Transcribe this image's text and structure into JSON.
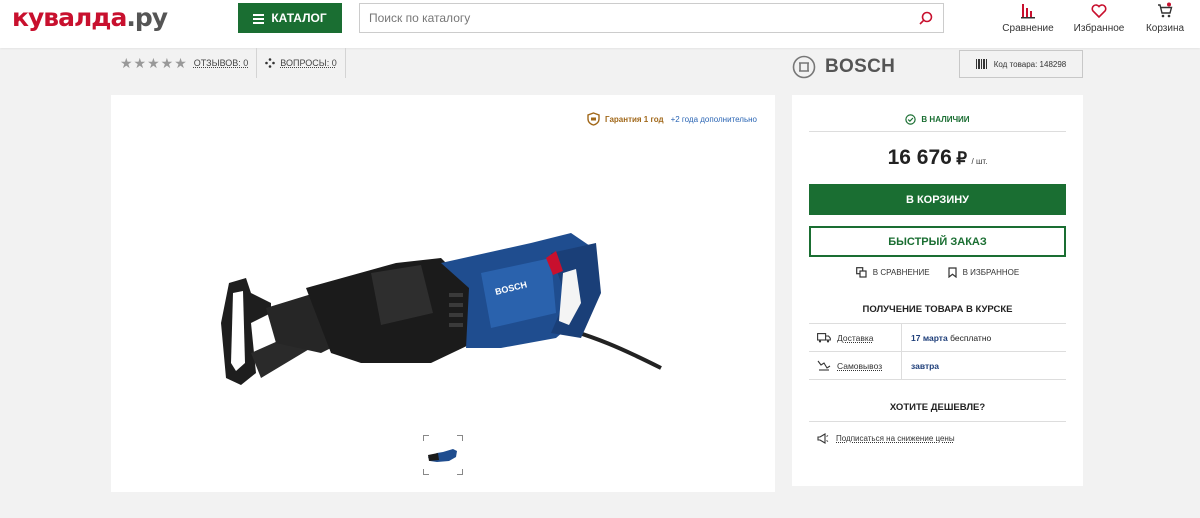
{
  "header": {
    "logo_main": "кувалда",
    "logo_suffix": ".ру",
    "catalog_label": "КАТАЛОГ",
    "search_placeholder": "Поиск по каталогу",
    "compare_label": "Сравнение",
    "favorites_label": "Избранное",
    "cart_label": "Корзина"
  },
  "rating": {
    "stars": "★★★★★",
    "reviews_label": "ОТЗЫВОВ: 0",
    "questions_label": "ВОПРОСЫ: 0"
  },
  "brand": {
    "name": "BOSCH"
  },
  "product_code": {
    "label": "Код товара: 148298"
  },
  "gallery": {
    "guarantee_main": "Гарантия 1 год",
    "guarantee_extra": "+2 года дополнительно"
  },
  "buy": {
    "stock_label": "В НАЛИЧИИ",
    "price": "16 676",
    "currency": "₽",
    "unit": "/ шт.",
    "cart_button": "В КОРЗИНУ",
    "quick_order_button": "БЫСТРЫЙ ЗАКАЗ",
    "compare_link": "В СРАВНЕНИЕ",
    "favorites_link": "В ИЗБРАННОЕ",
    "receive_title": "ПОЛУЧЕНИЕ ТОВАРА В КУРСКЕ",
    "delivery": {
      "label": "Доставка",
      "date": "17 марта",
      "note": "бесплатно"
    },
    "pickup": {
      "label": "Самовывоз",
      "date": "завтра"
    },
    "cheaper_title": "ХОТИТЕ ДЕШЕВЛЕ?",
    "subscribe_link": "Подписаться на снижение цены"
  },
  "colors": {
    "brand_green": "#1a6e32",
    "logo_red": "#c8102e",
    "link_blue": "#1f3f7a"
  }
}
